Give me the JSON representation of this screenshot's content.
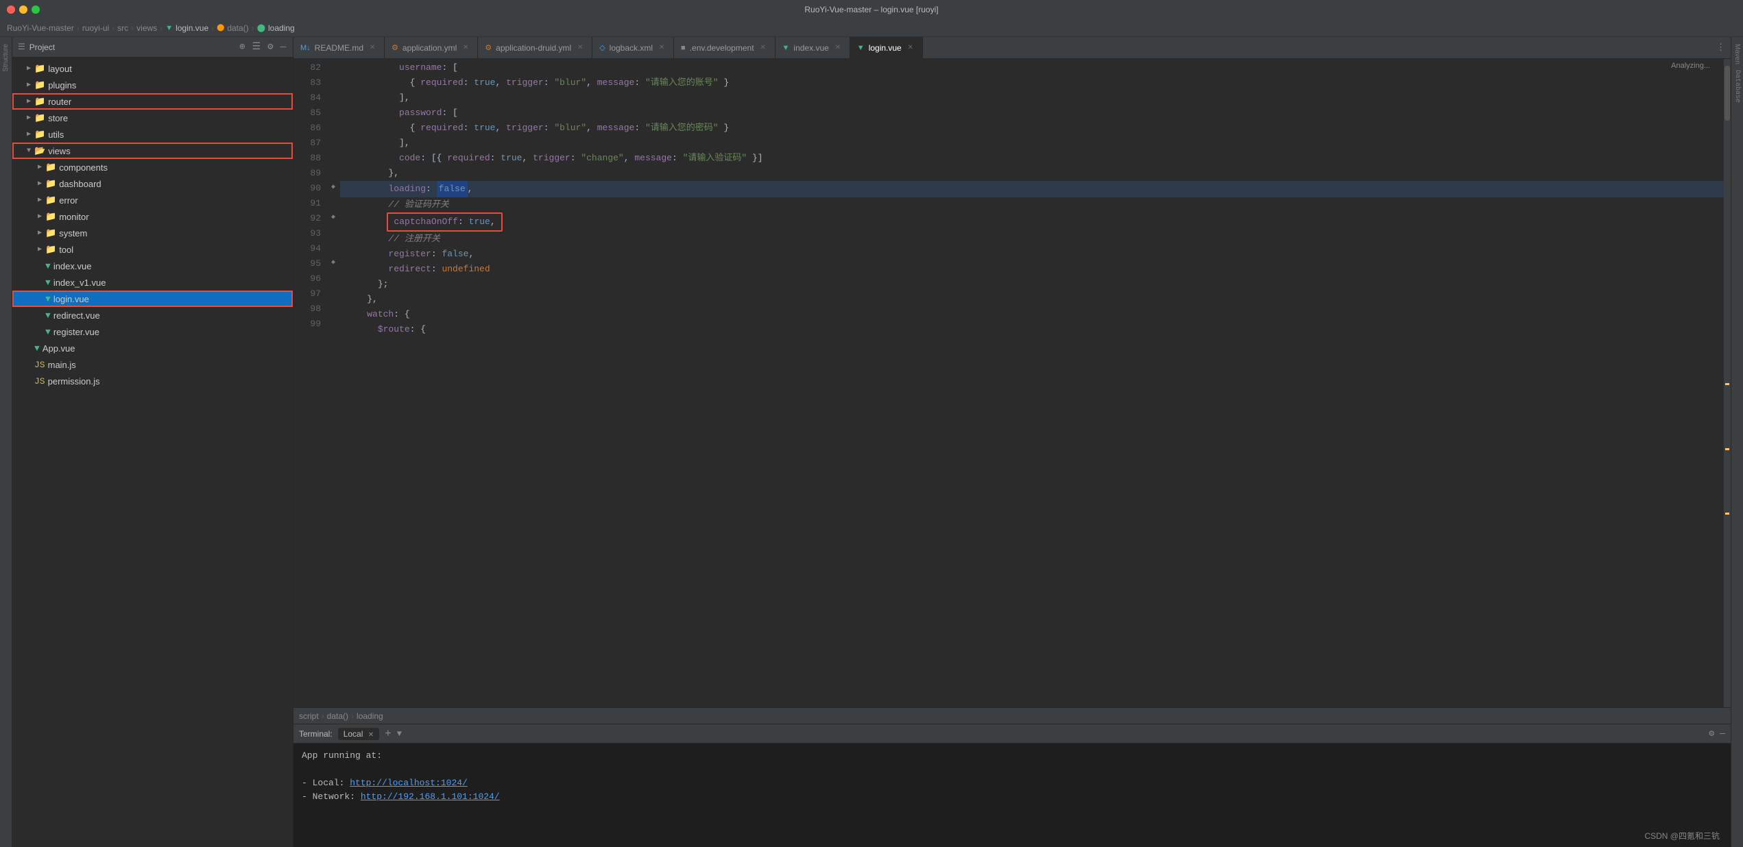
{
  "window": {
    "title": "RuoYi-Vue-master – login.vue [ruoyi]"
  },
  "breadcrumb": {
    "items": [
      "RuoYi-Vue-master",
      "ruoyi-ui",
      "src",
      "views",
      "login.vue",
      "data()",
      "loading"
    ]
  },
  "tabs": [
    {
      "label": "README.md",
      "active": false,
      "icon": "md"
    },
    {
      "label": "application.yml",
      "active": false,
      "icon": "yml"
    },
    {
      "label": "application-druid.yml",
      "active": false,
      "icon": "yml"
    },
    {
      "label": "logback.xml",
      "active": false,
      "icon": "xml"
    },
    {
      "label": ".env.development",
      "active": false,
      "icon": "env"
    },
    {
      "label": "index.vue",
      "active": false,
      "icon": "vue"
    },
    {
      "label": "login.vue",
      "active": true,
      "icon": "vue"
    }
  ],
  "file_tree": {
    "header": "Project",
    "items": [
      {
        "label": "layout",
        "type": "folder",
        "depth": 1,
        "open": false
      },
      {
        "label": "plugins",
        "type": "folder",
        "depth": 1,
        "open": false
      },
      {
        "label": "router",
        "type": "folder",
        "depth": 1,
        "open": false,
        "highlighted": true
      },
      {
        "label": "store",
        "type": "folder",
        "depth": 1,
        "open": false
      },
      {
        "label": "utils",
        "type": "folder",
        "depth": 1,
        "open": false
      },
      {
        "label": "views",
        "type": "folder",
        "depth": 1,
        "open": true,
        "red_outline": true
      },
      {
        "label": "components",
        "type": "folder",
        "depth": 2,
        "open": false
      },
      {
        "label": "dashboard",
        "type": "folder",
        "depth": 2,
        "open": false
      },
      {
        "label": "error",
        "type": "folder",
        "depth": 2,
        "open": false
      },
      {
        "label": "monitor",
        "type": "folder",
        "depth": 2,
        "open": false
      },
      {
        "label": "system",
        "type": "folder",
        "depth": 2,
        "open": false
      },
      {
        "label": "tool",
        "type": "folder",
        "depth": 2,
        "open": false
      },
      {
        "label": "index.vue",
        "type": "vue",
        "depth": 2
      },
      {
        "label": "index_v1.vue",
        "type": "vue",
        "depth": 2
      },
      {
        "label": "login.vue",
        "type": "vue",
        "depth": 2,
        "selected": true,
        "red_outline": true
      },
      {
        "label": "redirect.vue",
        "type": "vue",
        "depth": 2
      },
      {
        "label": "register.vue",
        "type": "vue",
        "depth": 2
      },
      {
        "label": "App.vue",
        "type": "vue",
        "depth": 0
      },
      {
        "label": "main.js",
        "type": "js",
        "depth": 0
      },
      {
        "label": "permission.js",
        "type": "js",
        "depth": 0
      }
    ]
  },
  "editor": {
    "lines": [
      {
        "num": 82,
        "content": "          username: [",
        "indent": ""
      },
      {
        "num": 83,
        "content": "            { required: true, trigger: \"blur\", message: \"请输入您的账号\" }",
        "indent": ""
      },
      {
        "num": 84,
        "content": "          ],",
        "indent": ""
      },
      {
        "num": 85,
        "content": "          password: [",
        "indent": ""
      },
      {
        "num": 86,
        "content": "            { required: true, trigger: \"blur\", message: \"请输入您的密码\" }",
        "indent": ""
      },
      {
        "num": 87,
        "content": "          ],",
        "indent": ""
      },
      {
        "num": 88,
        "content": "          code: [{ required: true, trigger: \"change\", message: \"请输入验证码\" }]",
        "indent": ""
      },
      {
        "num": 89,
        "content": "        },",
        "indent": ""
      },
      {
        "num": 90,
        "content": "        loading: false,",
        "indent": "",
        "special": "loading_false"
      },
      {
        "num": 91,
        "content": "        // 验证码开关",
        "indent": "",
        "comment": true
      },
      {
        "num": 92,
        "content": "        captchaOnOff: true,",
        "indent": "",
        "special": "captcha_redbox"
      },
      {
        "num": 93,
        "content": "        // 注册开关",
        "indent": "",
        "comment": true
      },
      {
        "num": 94,
        "content": "        register: false,",
        "indent": ""
      },
      {
        "num": 95,
        "content": "        redirect: undefined",
        "indent": ""
      },
      {
        "num": 96,
        "content": "      };",
        "indent": ""
      },
      {
        "num": 97,
        "content": "    },",
        "indent": ""
      },
      {
        "num": 98,
        "content": "    watch: {",
        "indent": ""
      },
      {
        "num": 99,
        "content": "      $route: {",
        "indent": ""
      }
    ]
  },
  "status_breadcrumb": {
    "items": [
      "script",
      "data()",
      "loading"
    ]
  },
  "terminal": {
    "label": "Terminal:",
    "tabs": [
      {
        "label": "Local",
        "active": true
      }
    ],
    "content": [
      "App running at:",
      "",
      "- Local:   http://localhost:1024/",
      "- Network: http://192.168.1.101:1024/"
    ],
    "local_url": "http://localhost:1024/",
    "network_url": "http://192.168.1.101:1024/"
  },
  "right_sidebar": {
    "label": "Maven"
  },
  "analyzing_text": "Analyzing...",
  "brand": "CSDN @四氪和三钪"
}
